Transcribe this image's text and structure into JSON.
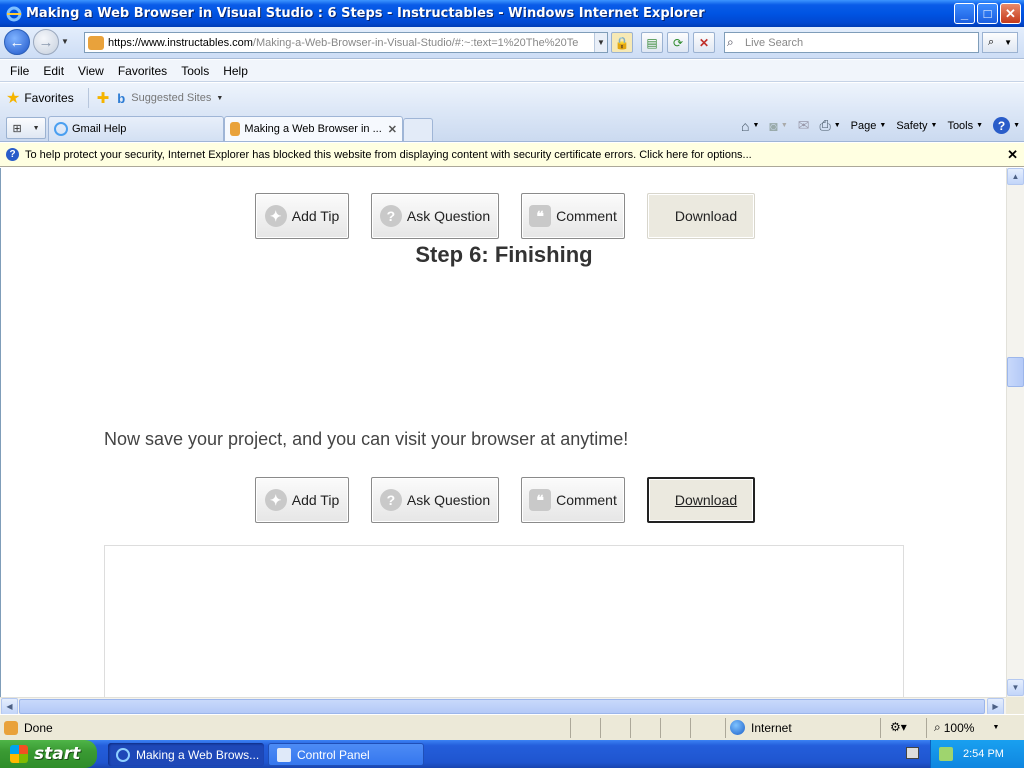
{
  "window": {
    "title": "Making a Web Browser in Visual Studio : 6 Steps - Instructables - Windows Internet Explorer",
    "controls": {
      "minimize": "_",
      "maximize": "□",
      "close": "✕"
    }
  },
  "address": {
    "url_prefix": "https://",
    "url_host": "www.instructables.com",
    "url_rest": "/Making-a-Web-Browser-in-Visual-Studio/#:~:text=1%20The%20Te",
    "search_placeholder": "Live Search"
  },
  "menu": [
    "File",
    "Edit",
    "View",
    "Favorites",
    "Tools",
    "Help"
  ],
  "favorites": {
    "label": "Favorites",
    "suggested": "Suggested Sites"
  },
  "tabs": [
    {
      "label": "Gmail Help",
      "active": false
    },
    {
      "label": "Making a Web Browser in ...",
      "active": true
    }
  ],
  "commands": [
    "Page",
    "Safety",
    "Tools"
  ],
  "infobar": {
    "text": "To help protect your security, Internet Explorer has blocked this website from displaying content with security certificate errors. Click here for options..."
  },
  "page": {
    "buttons_top": {
      "add_tip": "Add Tip",
      "ask_question": "Ask Question",
      "comment": "Comment",
      "download": "Download"
    },
    "step_title": "Step 6: Finishing",
    "body_text": "Now save your project, and you can visit your browser at anytime!",
    "buttons_bottom": {
      "add_tip": "Add Tip",
      "ask_question": "Ask Question",
      "comment": "Comment",
      "download": "Download"
    }
  },
  "status": {
    "text": "Done",
    "zone": "Internet",
    "zoom": "100%"
  },
  "taskbar": {
    "start": "start",
    "tasks": [
      {
        "label": "Making a Web Brows...",
        "active": true
      },
      {
        "label": "Control Panel",
        "active": false
      }
    ],
    "clock": "2:54 PM"
  }
}
